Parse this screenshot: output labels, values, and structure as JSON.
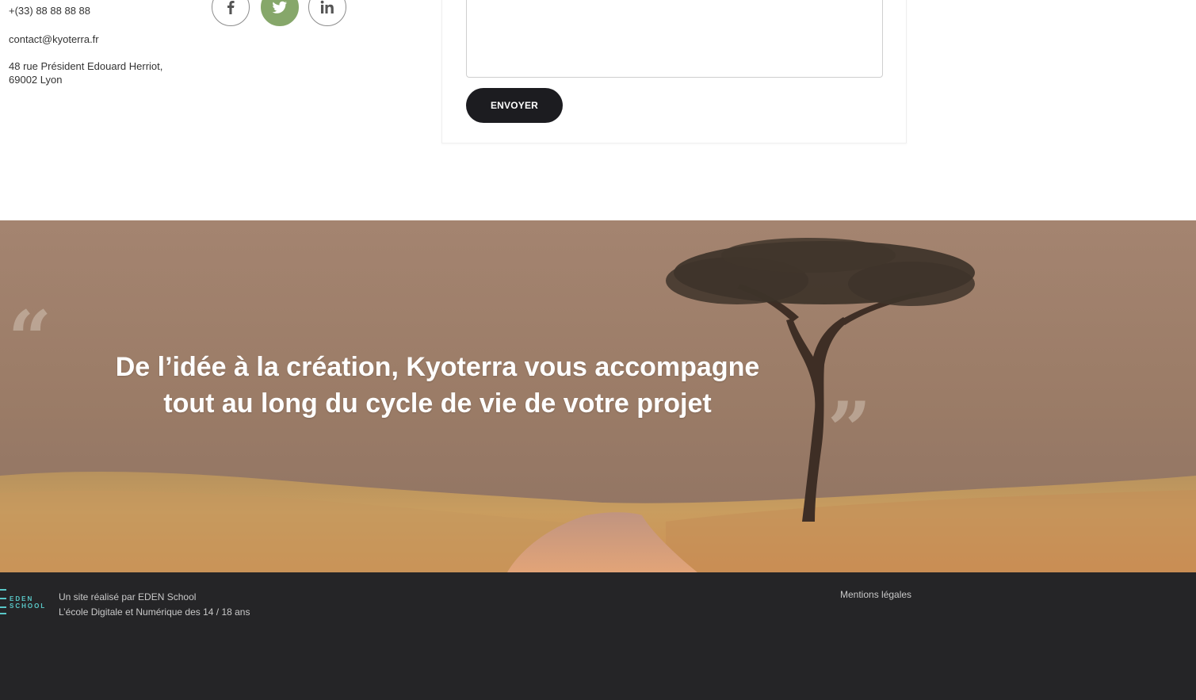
{
  "contact": {
    "phone": "+(33) 88 88 88 88",
    "email": "contact@kyoterra.fr",
    "address_line1": "48 rue Président Edouard Herriot,",
    "address_line2": "69002 Lyon"
  },
  "social": {
    "items": [
      {
        "name": "facebook",
        "icon": "facebook-icon"
      },
      {
        "name": "twitter",
        "icon": "twitter-bird-icon",
        "active_color": "#86a76a"
      },
      {
        "name": "linkedin",
        "icon": "linkedin-icon"
      }
    ]
  },
  "form": {
    "submit_label": "ENVOYER",
    "message_value": ""
  },
  "hero": {
    "quote_line1": "De l’idée à la création, Kyoterra vous accompagne",
    "quote_line2": "tout au long du cycle de vie de votre projet",
    "open_mark": "“",
    "close_mark": "”"
  },
  "footer": {
    "logo_line1": "EDEN",
    "logo_line2": "SCHOOL",
    "credit_line1": "Un site réalisé par EDEN School",
    "credit_line2": "L’école Digitale et Numérique des 14 / 18 ans",
    "legal_link": "Mentions légales",
    "background": "#252527",
    "accent": "#59c8c8"
  }
}
